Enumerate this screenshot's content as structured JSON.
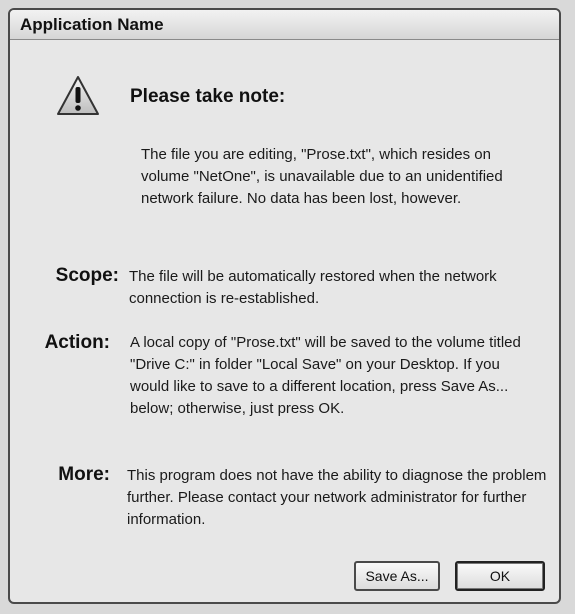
{
  "window": {
    "title": "Application Name"
  },
  "dialog": {
    "icon": "warning-icon",
    "heading": "Please take note:",
    "intro": "The file you are editing, \"Prose.txt\", which resides on volume \"NetOne\", is unavailable due to an unidentified network failure. No data has been lost, however.",
    "sections": [
      {
        "label": "Scope:",
        "text": "The file will be automatically restored when the network connection is re-established."
      },
      {
        "label": "Action:",
        "text": "A local copy of \"Prose.txt\" will be saved to the volume titled \"Drive C:\" in folder \"Local Save\" on your Desktop. If you would like to save to a different location, press Save As... below; otherwise, just press OK."
      },
      {
        "label": "More:",
        "text": "This program does not have the ability to diagnose the problem further. Please contact your network administrator for further information."
      }
    ]
  },
  "buttons": {
    "save_as": "Save As...",
    "ok": "OK"
  }
}
